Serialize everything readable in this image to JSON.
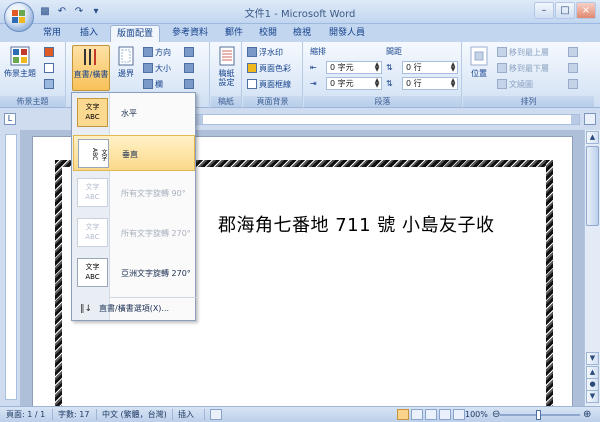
{
  "window": {
    "title": "文件1 - Microsoft Word"
  },
  "qat": {
    "icons": [
      "save-icon",
      "undo-icon",
      "redo-icon",
      "customize-icon"
    ]
  },
  "tabs": [
    {
      "label": "常用"
    },
    {
      "label": "插入"
    },
    {
      "label": "版面配置"
    },
    {
      "label": "參考資料"
    },
    {
      "label": "郵件"
    },
    {
      "label": "校閱"
    },
    {
      "label": "檢視"
    },
    {
      "label": "開發人員"
    }
  ],
  "ribbon": {
    "theme_group": {
      "label": "佈景主題",
      "theme_button": "佈景主題"
    },
    "page_setup": {
      "text_direction": "直書/橫書",
      "margins": "邊界",
      "orientation": "方向",
      "size": "大小",
      "columns": "欄"
    },
    "draft": {
      "button": "稿紙\n設定",
      "label": "稿紙"
    },
    "page_bg": {
      "watermark": "浮水印",
      "page_color": "頁面色彩",
      "page_borders": "頁面框線",
      "label": "頁面背景"
    },
    "paragraph": {
      "indent_label": "縮排",
      "spacing_label": "間距",
      "indent_left": "0 字元",
      "indent_right": "0 字元",
      "spacing_before": "0 行",
      "spacing_after": "0 行",
      "label": "段落"
    },
    "arrange": {
      "position": "位置",
      "bring_front": "移到最上層",
      "send_back": "移到最下層",
      "wrap_text": "文繞圖",
      "label": "排列"
    }
  },
  "menu": {
    "items": [
      {
        "icon_text": "文字\nABC",
        "label": "水平"
      },
      {
        "icon_text": "文字\nABC",
        "label": "垂直"
      },
      {
        "icon_text": "文字\nABC",
        "label": "所有文字旋轉 90°"
      },
      {
        "icon_text": "文字\nABC",
        "label": "所有文字旋轉 270°"
      },
      {
        "icon_text": "文字\nABC",
        "label": "亞洲文字旋轉 270°"
      }
    ],
    "options_label": "直書/橫書選項(X)..."
  },
  "document": {
    "text": "郡海角七番地 711 號  小島友子收"
  },
  "status": {
    "page": "頁面: 1 / 1",
    "words": "字數: 17",
    "language": "中文 (繁體，台灣)",
    "mode": "插入",
    "zoom": "100%"
  },
  "colors": {
    "ribbon_bg": "#dce8f7",
    "accent": "#fcd98a",
    "text": "#15428b"
  }
}
